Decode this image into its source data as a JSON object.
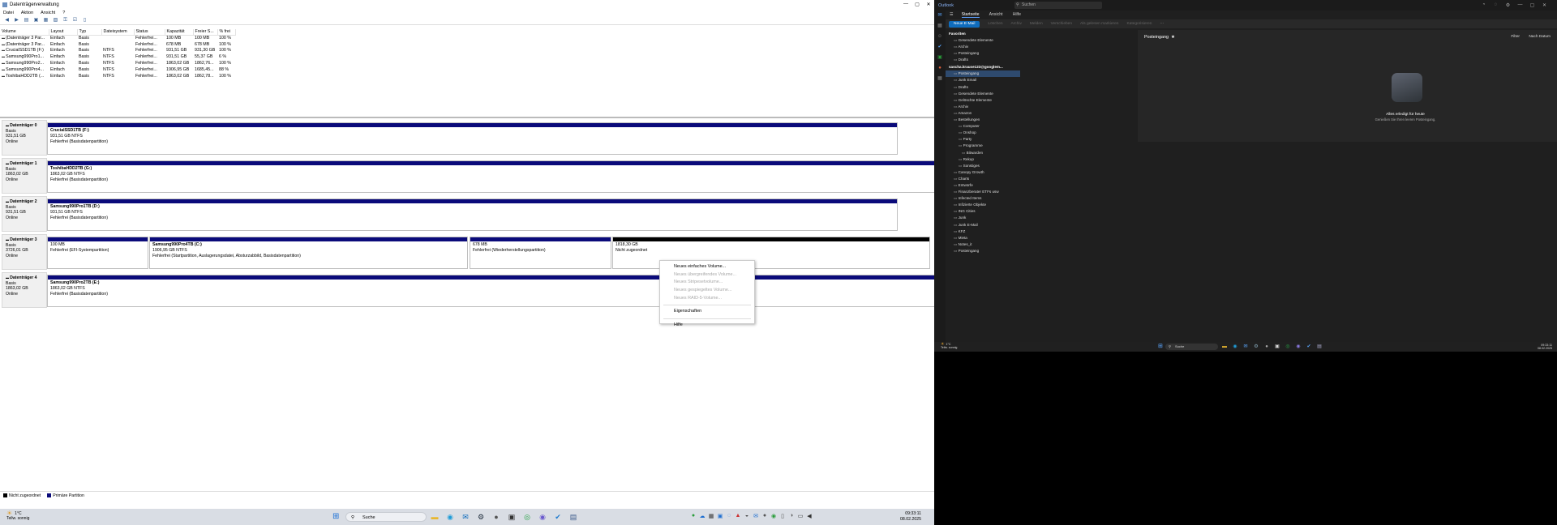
{
  "dm": {
    "title": "Datenträgerverwaltung",
    "window_controls": [
      "—",
      "▢",
      "✕"
    ],
    "menu": [
      "Datei",
      "Aktion",
      "Ansicht",
      "?"
    ],
    "toolbar_icons": [
      "back-icon",
      "forward-icon",
      "list-icon",
      "help-icon",
      "properties-icon",
      "view-icon",
      "key-icon",
      "check-icon",
      "doc-icon"
    ],
    "table": {
      "headers": [
        "Volume",
        "Layout",
        "Typ",
        "Dateisystem",
        "Status",
        "Kapazität",
        "Freier S...",
        "% frei"
      ],
      "rows": [
        [
          "(Datenträger 3 Par...",
          "Einfach",
          "Basis",
          "",
          "Fehlerfrei...",
          "100 MB",
          "100 MB",
          "100 %"
        ],
        [
          "(Datenträger 3 Par...",
          "Einfach",
          "Basis",
          "",
          "Fehlerfrei...",
          "678 MB",
          "678 MB",
          "100 %"
        ],
        [
          "CrucialSSD1TB (F:)",
          "Einfach",
          "Basis",
          "NTFS",
          "Fehlerfrei...",
          "931,51 GB",
          "931,30 GB",
          "100 %"
        ],
        [
          "Samsung990Pro1...",
          "Einfach",
          "Basis",
          "NTFS",
          "Fehlerfrei...",
          "931,51 GB",
          "55,37 GB",
          "6 %"
        ],
        [
          "Samsung990Pro2...",
          "Einfach",
          "Basis",
          "NTFS",
          "Fehlerfrei...",
          "1863,02 GB",
          "1862,76...",
          "100 %"
        ],
        [
          "Samsung990Pro4...",
          "Einfach",
          "Basis",
          "NTFS",
          "Fehlerfrei...",
          "1906,95 GB",
          "1685,45...",
          "88 %"
        ],
        [
          "ToshibaHDD2TB (...",
          "Einfach",
          "Basis",
          "NTFS",
          "Fehlerfrei...",
          "1863,02 GB",
          "1862,78...",
          "100 %"
        ]
      ]
    },
    "disks": [
      {
        "name": "Datenträger 0",
        "type": "Basis",
        "size": "931,51 GB",
        "status": "Online",
        "partitions": [
          {
            "title": "CrucialSSD1TB  (F:)",
            "line1": "931,51 GB NTFS",
            "line2": "Fehlerfrei (Basisdatenpartition)"
          }
        ]
      },
      {
        "name": "Datenträger 1",
        "type": "Basis",
        "size": "1863,02 GB",
        "status": "Online",
        "partitions": [
          {
            "title": "ToshibaHDD2TB  (G:)",
            "line1": "1863,02 GB NTFS",
            "line2": "Fehlerfrei (Basisdatenpartition)"
          }
        ]
      },
      {
        "name": "Datenträger 2",
        "type": "Basis",
        "size": "931,51 GB",
        "status": "Online",
        "partitions": [
          {
            "title": "Samsung990Pro1TB  (D:)",
            "line1": "931,51 GB NTFS",
            "line2": "Fehlerfrei (Basisdatenpartition)"
          }
        ]
      },
      {
        "name": "Datenträger 3",
        "type": "Basis",
        "size": "3726,01 GB",
        "status": "Online",
        "partitions": [
          {
            "title": "",
            "line1": "100 MB",
            "line2": "Fehlerfrei (EFI-Systempartition)"
          },
          {
            "title": "Samsung990Pro4TB  (C:)",
            "line1": "1906,95 GB NTFS",
            "line2": "Fehlerfrei (Startpartition, Auslagerungsdatei, Absturzabbild, Basisdatenpartition)"
          },
          {
            "title": "",
            "line1": "678 MB",
            "line2": "Fehlerfrei (Wiederherstellungspartition)"
          },
          {
            "title": "",
            "line1": "1818,30 GB",
            "line2": "Nicht zugeordnet"
          }
        ]
      },
      {
        "name": "Datenträger 4",
        "type": "Basis",
        "size": "1863,02 GB",
        "status": "Online",
        "partitions": [
          {
            "title": "Samsung990Pro2TB  (E:)",
            "line1": "1863,02 GB NTFS",
            "line2": "Fehlerfrei (Basisdatenpartition)"
          }
        ]
      }
    ],
    "legend": [
      {
        "label": "Nicht zugeordnet",
        "color": "#000000"
      },
      {
        "label": "Primäre Partition",
        "color": "#0a0a7a"
      }
    ],
    "context_menu": [
      {
        "label": "Neues einfaches Volume...",
        "disabled": false
      },
      {
        "label": "Neues übergreifendes Volume...",
        "disabled": true
      },
      {
        "label": "Neues Stripesetvolume...",
        "disabled": true
      },
      {
        "label": "Neues gespiegeltes Volume...",
        "disabled": true
      },
      {
        "label": "Neues RAID-5-Volume...",
        "disabled": true
      },
      {
        "label": "Eigenschaften",
        "disabled": false
      },
      {
        "label": "Hilfe",
        "disabled": false
      }
    ]
  },
  "taskbar_left": {
    "temp": "1°C",
    "weather": "Teilw. sonnig",
    "search": "Suche",
    "time": "09:33:11",
    "date": "08.02.2025",
    "app_icons": [
      "file-explorer-icon",
      "edge-icon",
      "outlook-icon",
      "steam-icon",
      "app-icon",
      "clipboard-icon",
      "whatsapp-icon",
      "app-icon",
      "vscode-icon",
      "disk-management-icon"
    ]
  },
  "outlook": {
    "brand": "Outlook",
    "search_placeholder": "Suchen",
    "menu": [
      "Startseite",
      "Ansicht",
      "Hilfe"
    ],
    "new_mail": "Neue E-Mail",
    "ribbon": [
      "Löschen",
      "Archiv",
      "Melden",
      "Verschieben",
      "Als gelesen markieren",
      "Kategorisieren"
    ],
    "favorites_label": "Favoriten",
    "favorites": [
      "Gesendete Elemente",
      "Archiv",
      "Posteingang",
      "Drafts"
    ],
    "account_label": "sascha.krause123@googlem...",
    "folders": [
      "Posteingang",
      "Junk Email",
      "Drafts",
      "Gesendete Elemente",
      "Gelöschte Elemente",
      "Archiv",
      "Amazon",
      "Bestellungen",
      "Computer",
      "Onshop",
      "Party",
      "Programme",
      "Bitwarden",
      "Rekup",
      "Sonstiges",
      "Canopy Growth",
      "Charts",
      "Entwürfe",
      "Finanzberater ETFs usw",
      "Infected Items",
      "Infizierte Objekte",
      "ING Cities",
      "Junk",
      "Junk E-Mail",
      "KFZ",
      "Mieta",
      "Notes_it",
      "Posteingang"
    ],
    "header": "Posteingang",
    "filter": "Filter",
    "sort": "Nach Datum",
    "empty_title": "Alles erledigt für heute",
    "empty_sub": "Genießen Sie Ihren leeren Posteingang.",
    "taskbar": {
      "temp": "1°C",
      "weather": "Teilw. sonnig",
      "search": "Suche",
      "time": "09:33:11",
      "date": "08.02.2025"
    }
  }
}
